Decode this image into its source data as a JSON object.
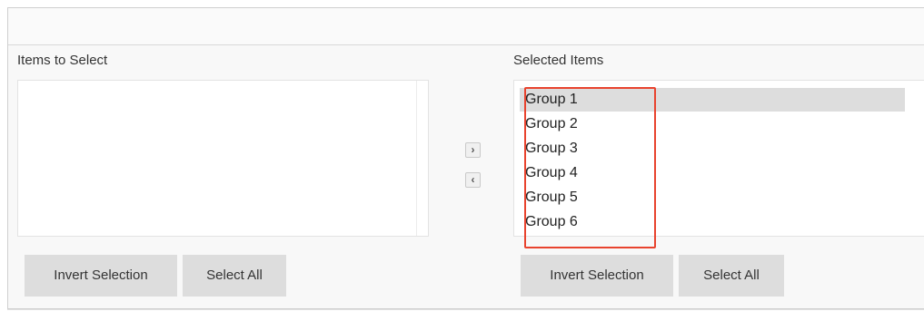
{
  "left_column": {
    "label": "Items to Select",
    "items": [],
    "invert_label": "Invert Selection",
    "select_all_label": "Select All"
  },
  "right_column": {
    "label": "Selected Items",
    "items": [
      "Group 1",
      "Group 2",
      "Group 3",
      "Group 4",
      "Group 5",
      "Group 6"
    ],
    "selected_item": "Group 1",
    "invert_label": "Invert Selection",
    "select_all_label": "Select All"
  },
  "transfer": {
    "move_right_glyph": "›",
    "move_left_glyph": "‹"
  },
  "colors": {
    "highlight_border": "#e8432e",
    "selected_row": "#dddddd",
    "button_bg": "#dddddd"
  }
}
